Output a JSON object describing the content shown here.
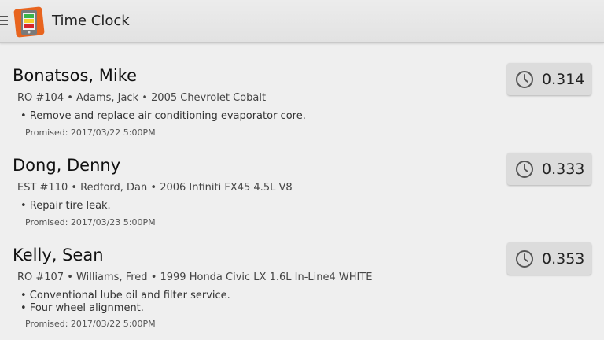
{
  "app": {
    "title": "Time Clock"
  },
  "jobs": [
    {
      "name": "Bonatsos, Mike",
      "ro": "RO #104 • Adams, Jack • 2005 Chevrolet Cobalt",
      "tasks": [
        "• Remove and replace air conditioning evaporator core."
      ],
      "promised": "Promised: 2017/03/22 5:00PM",
      "hours": "0.314"
    },
    {
      "name": "Dong, Denny",
      "ro": "EST #110 • Redford, Dan • 2006 Infiniti FX45  4.5L V8",
      "tasks": [
        "• Repair tire leak."
      ],
      "promised": "Promised: 2017/03/23 5:00PM",
      "hours": "0.333"
    },
    {
      "name": "Kelly, Sean",
      "ro": "RO #107 • Williams, Fred • 1999 Honda Civic LX 1.6L In-Line4 WHITE",
      "tasks": [
        "• Conventional lube oil and filter service.",
        "• Four wheel alignment."
      ],
      "promised": "Promised: 2017/03/22 5:00PM",
      "hours": "0.353"
    }
  ],
  "colors": {
    "app_icon_frame": "#e8641e",
    "app_icon_green": "#3ab54a",
    "app_icon_yellow": "#f5d02a",
    "app_icon_red": "#d8262a"
  }
}
